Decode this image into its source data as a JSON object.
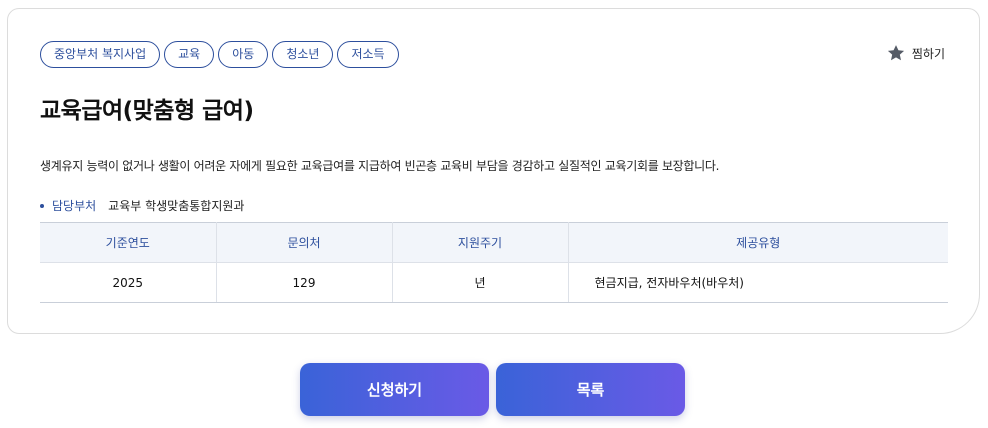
{
  "tags": [
    "중앙부처 복지사업",
    "교육",
    "아동",
    "청소년",
    "저소득"
  ],
  "favorite": {
    "label": "찜하기",
    "icon": "star-icon"
  },
  "title": "교육급여(맞춤형 급여)",
  "description": "생계유지 능력이 없거나 생활이 어려운 자에게 필요한 교육급여를 지급하여 빈곤층 교육비 부담을 경감하고 실질적인 교육기회를 보장합니다.",
  "department": {
    "label": "담당부처",
    "value": "교육부 학생맞춤통합지원과"
  },
  "table": {
    "headers": [
      "기준연도",
      "문의처",
      "지원주기",
      "제공유형"
    ],
    "row": [
      "2025",
      "129",
      "년",
      "현금지급, 전자바우처(바우처)"
    ]
  },
  "buttons": {
    "apply": "신청하기",
    "list": "목록"
  },
  "colors": {
    "accent": "#2d4f9d",
    "button_start": "#3a63d8",
    "button_end": "#6a5ae6"
  }
}
